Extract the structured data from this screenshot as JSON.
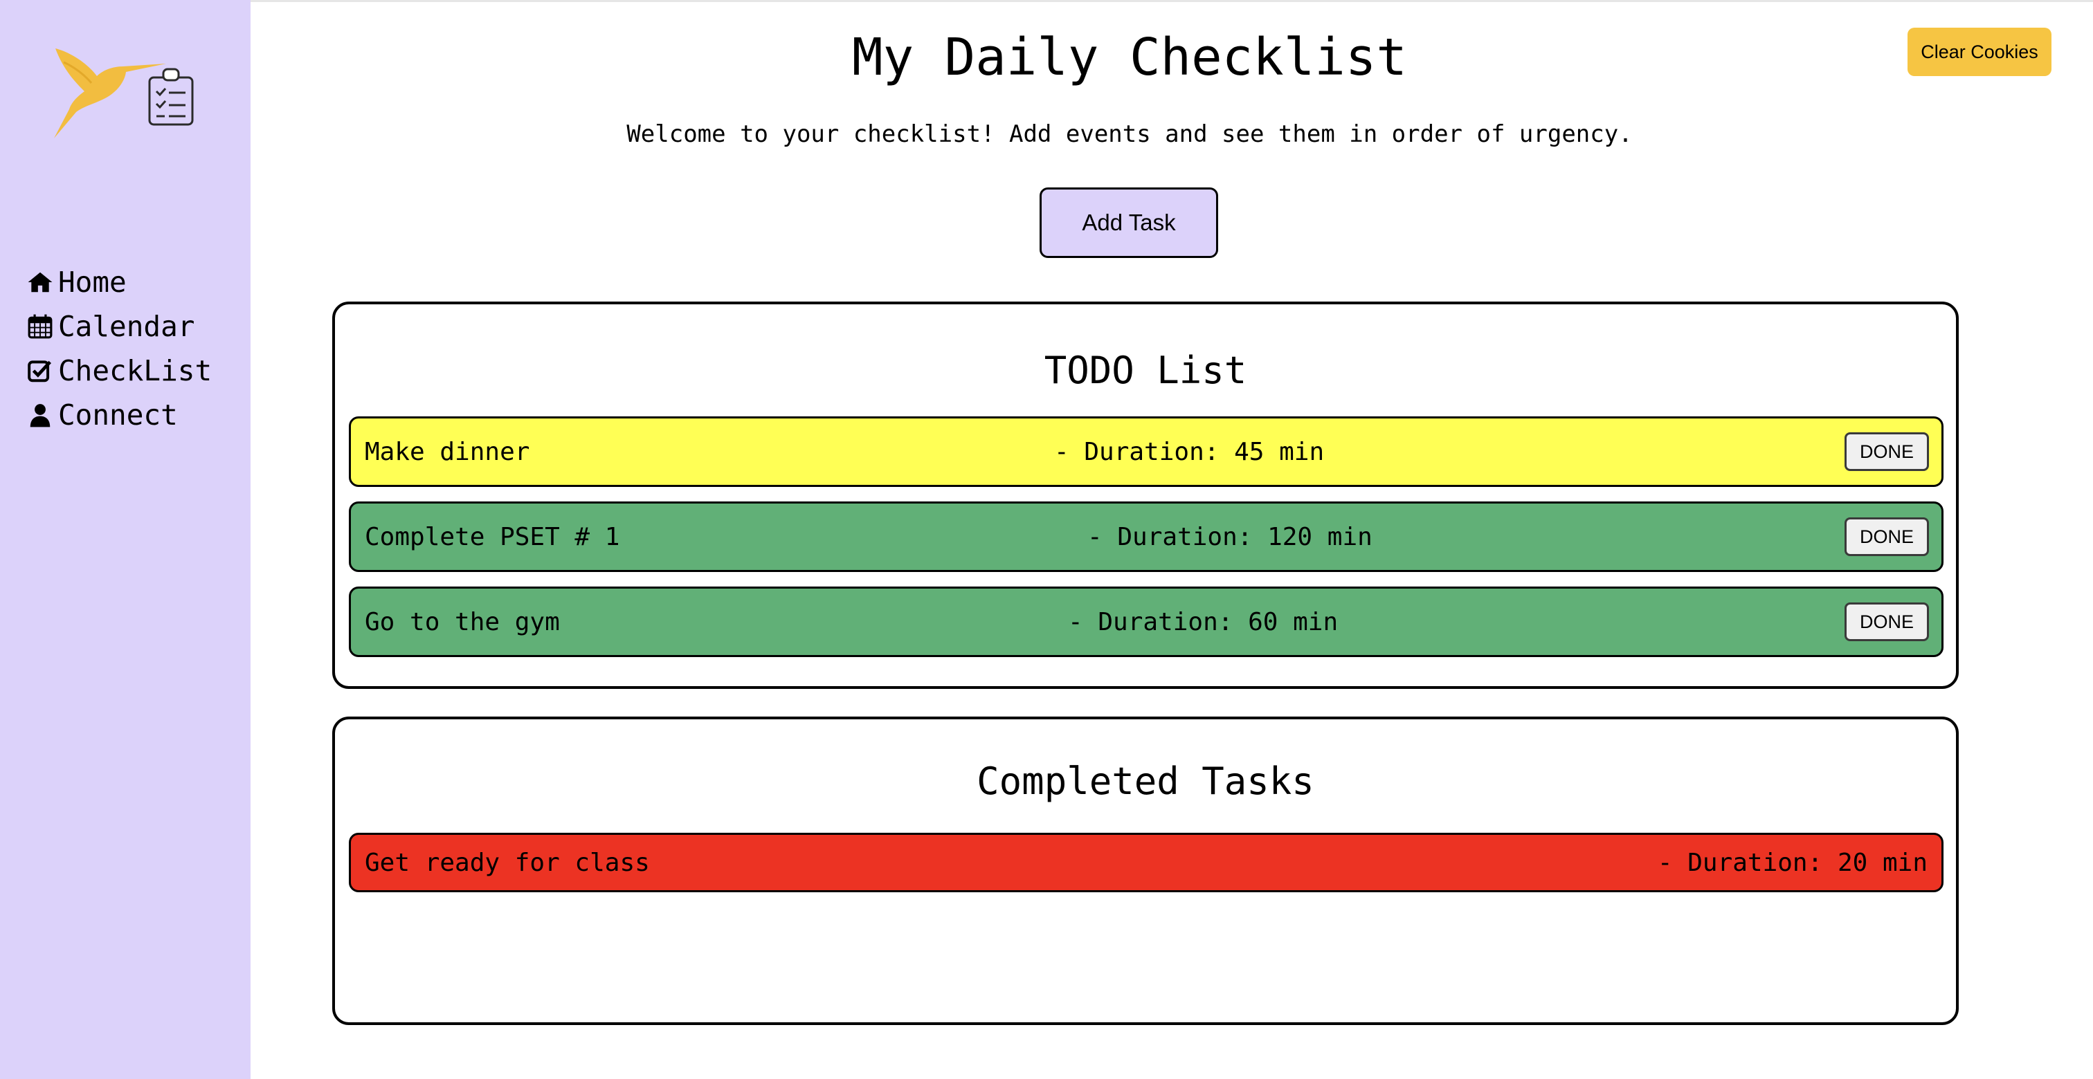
{
  "sidebar": {
    "logo_icon": "hummingbird-checklist-logo",
    "items": [
      {
        "label": "Home",
        "icon": "home-icon"
      },
      {
        "label": "Calendar",
        "icon": "calendar-icon"
      },
      {
        "label": "CheckList",
        "icon": "checkbox-icon"
      },
      {
        "label": "Connect",
        "icon": "user-icon"
      }
    ]
  },
  "header": {
    "title": "My Daily Checklist",
    "welcome": "Welcome to your checklist! Add events and see them in order of urgency.",
    "clear_cookies_label": "Clear Cookies",
    "add_task_label": "Add Task"
  },
  "todo": {
    "title": "TODO List",
    "tasks": [
      {
        "name": "Make dinner",
        "duration": "- Duration: 45 min",
        "done_label": "DONE",
        "color": "#ffff55"
      },
      {
        "name": "Complete PSET # 1",
        "duration": "- Duration: 120 min",
        "done_label": "DONE",
        "color": "#61b077"
      },
      {
        "name": "Go to the gym",
        "duration": "- Duration: 60 min",
        "done_label": "DONE",
        "color": "#61b077"
      }
    ]
  },
  "completed": {
    "title": "Completed Tasks",
    "tasks": [
      {
        "name": "Get ready for class",
        "duration": "- Duration: 20 min",
        "color": "#ec3323"
      }
    ]
  },
  "colors": {
    "sidebar_bg": "#dcd2fa",
    "accent_yellow": "#f6c543",
    "logo_bird": "#f2bd40"
  }
}
